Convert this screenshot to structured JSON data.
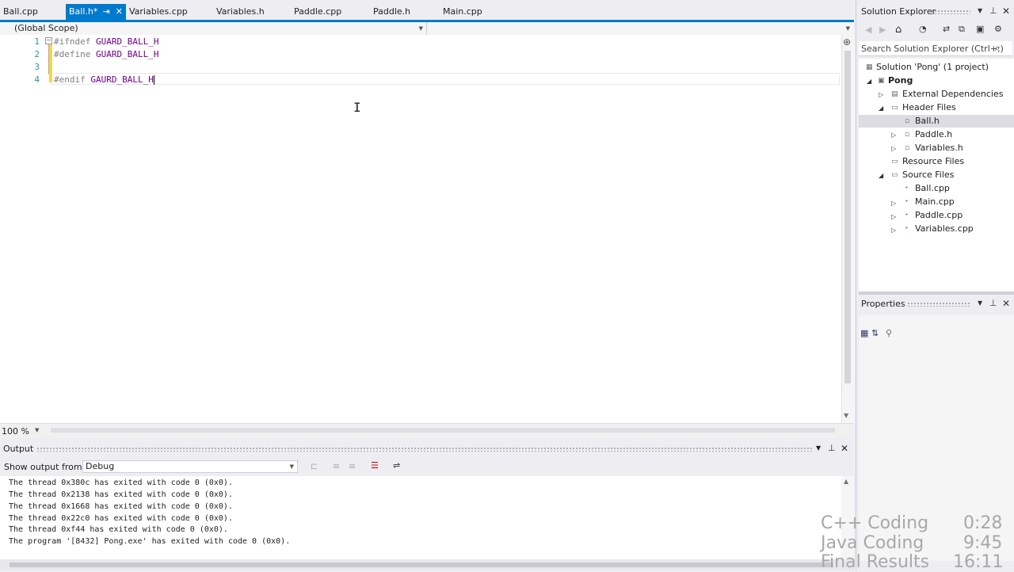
{
  "tabs": [
    {
      "label": "Ball.cpp"
    },
    {
      "label": "Ball.h*"
    },
    {
      "label": "Variables.cpp"
    },
    {
      "label": "Variables.h"
    },
    {
      "label": "Paddle.cpp"
    },
    {
      "label": "Paddle.h"
    },
    {
      "label": "Main.cpp"
    }
  ],
  "scope": {
    "label": "(Global Scope)"
  },
  "editor": {
    "lines": [
      {
        "num": "1",
        "kw": "#ifndef",
        "rest": " GUARD_BALL_H"
      },
      {
        "num": "2",
        "kw": "#define",
        "rest": " GUARD_BALL_H"
      },
      {
        "num": "3",
        "kw": "",
        "rest": ""
      },
      {
        "num": "4",
        "kw": "#endif",
        "rest": " GAURD_BALL_H"
      }
    ]
  },
  "zoom": "100 %",
  "output": {
    "title": "Output",
    "show_from_label": "Show output from:",
    "source": "Debug",
    "lines": [
      "The thread 0x380c has exited with code 0 (0x0).",
      "The thread 0x2138 has exited with code 0 (0x0).",
      "The thread 0x1668 has exited with code 0 (0x0).",
      "The thread 0x22c0 has exited with code 0 (0x0).",
      "The thread 0xf44 has exited with code 0 (0x0).",
      "The program '[8432] Pong.exe' has exited with code 0 (0x0)."
    ]
  },
  "solution_explorer": {
    "title": "Solution Explorer",
    "search_placeholder": "Search Solution Explorer (Ctrl+;)",
    "tree": [
      {
        "label": "Solution 'Pong' (1 project)"
      },
      {
        "label": "Pong"
      },
      {
        "label": "External Dependencies"
      },
      {
        "label": "Header Files"
      },
      {
        "label": "Ball.h"
      },
      {
        "label": "Paddle.h"
      },
      {
        "label": "Variables.h"
      },
      {
        "label": "Resource Files"
      },
      {
        "label": "Source Files"
      },
      {
        "label": "Ball.cpp"
      },
      {
        "label": "Main.cpp"
      },
      {
        "label": "Paddle.cpp"
      },
      {
        "label": "Variables.cpp"
      }
    ]
  },
  "properties": {
    "title": "Properties"
  },
  "overlay": {
    "items": [
      {
        "name": "C++ Coding",
        "time": "0:28"
      },
      {
        "name": "Java Coding",
        "time": "9:45"
      },
      {
        "name": "Final Results",
        "time": "16:11"
      }
    ]
  }
}
